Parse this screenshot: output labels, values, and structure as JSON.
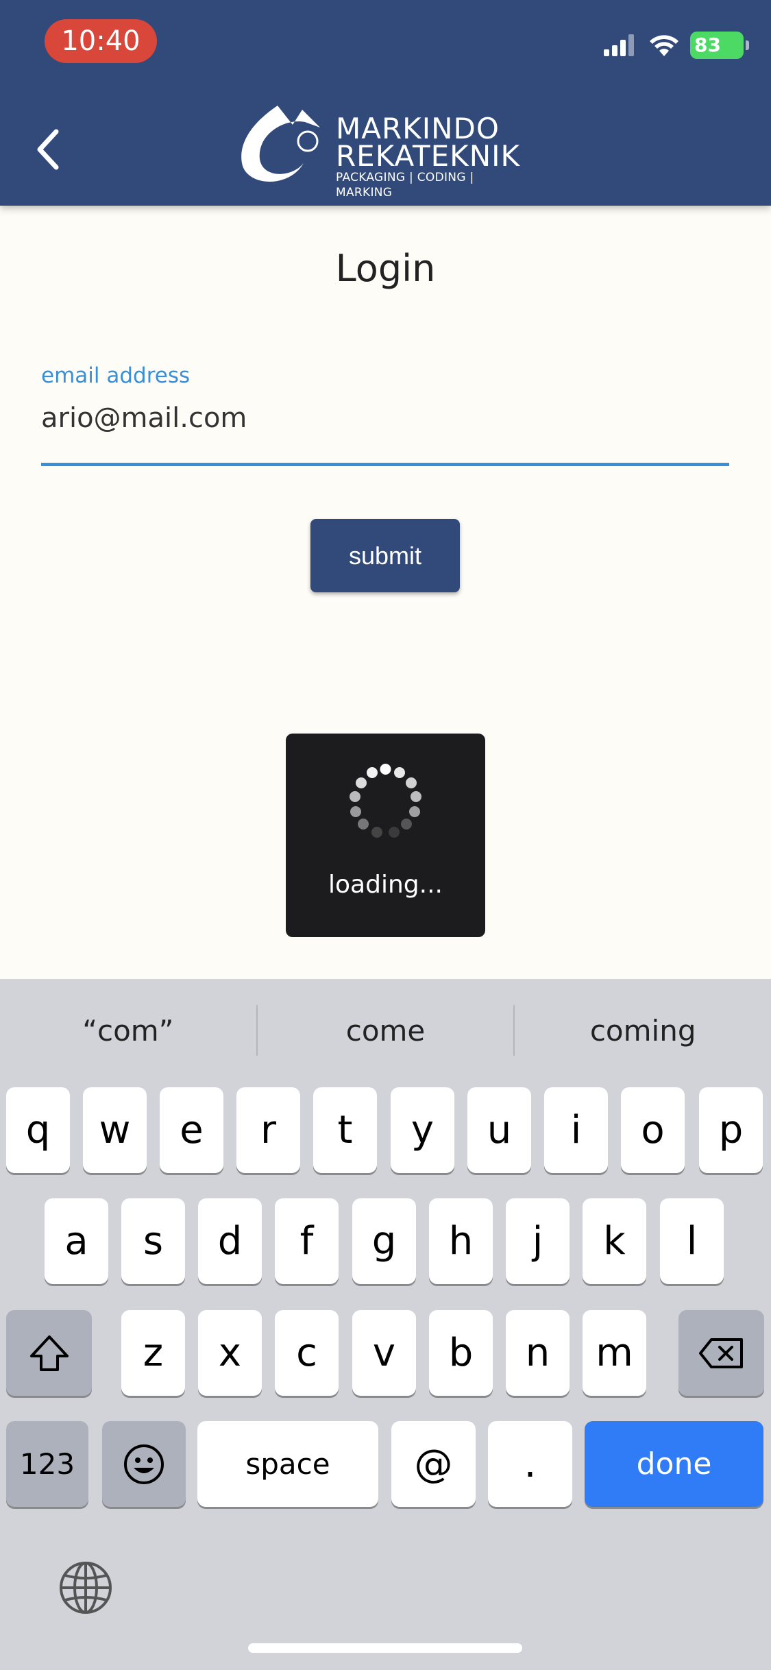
{
  "status_bar": {
    "time": "10:40",
    "battery": "83"
  },
  "header": {
    "brand_line1": "MARKINDO",
    "brand_line2": "REKATEKNIK",
    "brand_tagline": "PACKAGING | CODING | MARKING",
    "brand_mark": "®"
  },
  "login": {
    "title": "Login",
    "email_label": "email address",
    "email_value": "ario@mail.com",
    "submit_label": "submit"
  },
  "loading": {
    "text": "loading..."
  },
  "keyboard": {
    "suggestions": [
      "“com”",
      "come",
      "coming"
    ],
    "row1": [
      "q",
      "w",
      "e",
      "r",
      "t",
      "y",
      "u",
      "i",
      "o",
      "p"
    ],
    "row2": [
      "a",
      "s",
      "d",
      "f",
      "g",
      "h",
      "j",
      "k",
      "l"
    ],
    "row3": [
      "z",
      "x",
      "c",
      "v",
      "b",
      "n",
      "m"
    ],
    "numbers_label": "123",
    "space_label": "space",
    "at_label": "@",
    "dot_label": ".",
    "done_label": "done"
  },
  "colors": {
    "header": "#314a7a",
    "accent": "#3b8fd6",
    "done": "#2f7cf6"
  }
}
